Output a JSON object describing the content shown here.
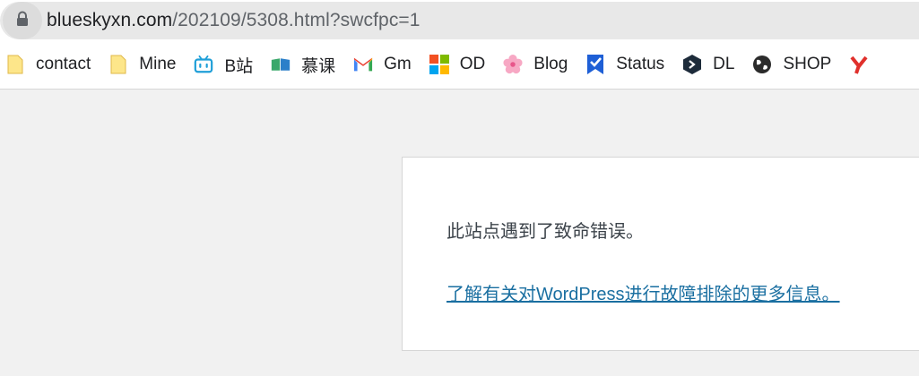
{
  "address_bar": {
    "host": "blueskyxn.com",
    "path": "/202109/5308.html?swcfpc=1",
    "icon": "lock-icon"
  },
  "bookmarks": [
    {
      "label": "contact",
      "icon": "folder-icon"
    },
    {
      "label": "Mine",
      "icon": "folder-icon"
    },
    {
      "label": "B站",
      "icon": "bilibili-icon"
    },
    {
      "label": "慕课",
      "icon": "mooc-icon"
    },
    {
      "label": "Gm",
      "icon": "gmail-icon"
    },
    {
      "label": "OD",
      "icon": "microsoft-icon"
    },
    {
      "label": "Blog",
      "icon": "flower-icon"
    },
    {
      "label": "Status",
      "icon": "status-check-icon"
    },
    {
      "label": "DL",
      "icon": "dl-hexagon-icon"
    },
    {
      "label": "SHOP",
      "icon": "globe-icon"
    }
  ],
  "error_page": {
    "message": "此站点遇到了致命错误。",
    "link_text": "了解有关对WordPress进行故障排除的更多信息。"
  },
  "colors": {
    "page_background": "#f1f1f1",
    "link": "#1a6fa1",
    "text": "#3c434a",
    "address_bar": "#e8e8e8"
  }
}
